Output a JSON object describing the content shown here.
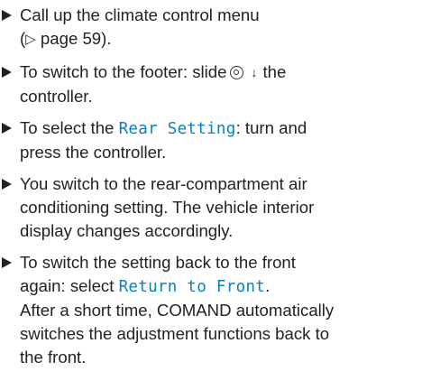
{
  "steps": [
    {
      "line1": "Call up the climate control menu",
      "ref_prefix": "(",
      "ref_icon": "▷",
      "ref_text": " page 59)."
    },
    {
      "pre": "To switch to the footer: slide",
      "control_icon": "controller-icon",
      "arrow_icon": "↓",
      "post": "the",
      "line2": "controller."
    },
    {
      "pre": "To select the ",
      "highlight": "Rear Setting",
      "post": ": turn and",
      "line2": "press the controller."
    },
    {
      "line1": "You switch to the rear-compartment air",
      "line2": "conditioning setting. The vehicle interior",
      "line3": "display changes accordingly."
    },
    {
      "line1": "To switch the setting back to the front",
      "line2_pre": "again: select ",
      "highlight": "Return to Front",
      "line2_post": ".",
      "line3": "After a short time, COMAND automatically",
      "line4": "switches the adjustment functions back to",
      "line5": "the front."
    }
  ]
}
